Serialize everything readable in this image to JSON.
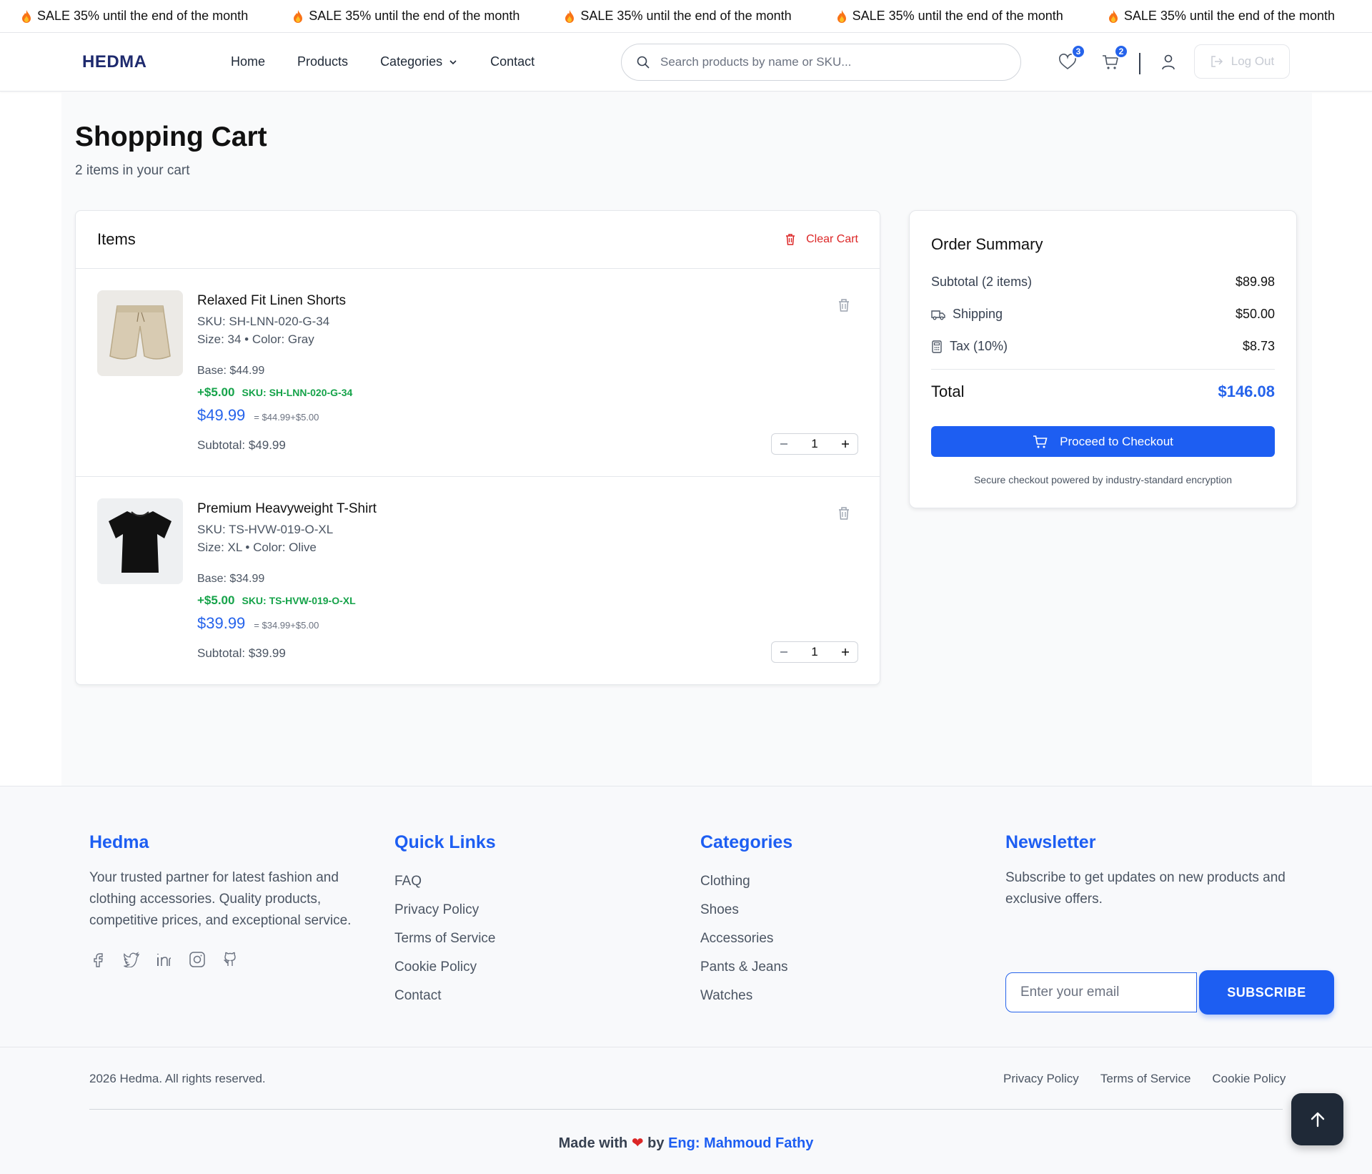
{
  "ticker": {
    "items": [
      "SALE 35% until the end of the month",
      "SALE 35% until the end of the month",
      "SALE 35% until the end of the month",
      "SALE 35% until the end of the month",
      "SALE 35% until the end of the month"
    ]
  },
  "nav": {
    "logo": "HEDMA",
    "links": [
      "Home",
      "Products",
      "Categories",
      "Contact"
    ],
    "search_placeholder": "Search products by name or SKU...",
    "wishlist_count": "3",
    "cart_count": "2",
    "logout_label": "Log Out"
  },
  "page": {
    "title": "Shopping Cart",
    "subtitle": "2 items in your cart"
  },
  "cart": {
    "header": "Items",
    "clear_label": "Clear Cart",
    "items": [
      {
        "name": "Relaxed Fit Linen Shorts",
        "sku": "SKU: SH-LNN-020-G-34",
        "options": "Size: 34 • Color: Gray",
        "base": "Base: $44.99",
        "extra": "+$5.00",
        "extra_sku": "SKU: SH-LNN-020-G-34",
        "price": "$49.99",
        "formula": "= $44.99+$5.00",
        "subtotal": "Subtotal: $49.99",
        "qty": "1",
        "image": "linen-shorts-photo"
      },
      {
        "name": "Premium Heavyweight T-Shirt",
        "sku": "SKU: TS-HVW-019-O-XL",
        "options": "Size: XL • Color: Olive",
        "base": "Base: $34.99",
        "extra": "+$5.00",
        "extra_sku": "SKU: TS-HVW-019-O-XL",
        "price": "$39.99",
        "formula": "= $34.99+$5.00",
        "subtotal": "Subtotal: $39.99",
        "qty": "1",
        "image": "black-tshirt-photo"
      }
    ]
  },
  "summary": {
    "title": "Order Summary",
    "subtotal_label": "Subtotal (2 items)",
    "subtotal": "$89.98",
    "shipping_label": "Shipping",
    "shipping": "$50.00",
    "tax_label": "Tax (10%)",
    "tax": "$8.73",
    "total_label": "Total",
    "total": "$146.08",
    "checkout_label": "Proceed to Checkout",
    "secure_note": "Secure checkout powered by industry-standard encryption"
  },
  "footer": {
    "brand_title": "Hedma",
    "brand_text": "Your trusted partner for latest fashion and clothing accessories. Quality products, competitive prices, and exceptional service.",
    "quick_title": "Quick Links",
    "quick_links": [
      "FAQ",
      "Privacy Policy",
      "Terms of Service",
      "Cookie Policy",
      "Contact"
    ],
    "categories_title": "Categories",
    "categories": [
      "Clothing",
      "Shoes",
      "Accessories",
      "Pants & Jeans",
      "Watches"
    ],
    "newsletter_title": "Newsletter",
    "newsletter_text": "Subscribe to get updates on new products and exclusive offers.",
    "email_placeholder": "Enter your email",
    "subscribe_label": "SUBSCRIBE",
    "copyright": "2026 Hedma. All rights reserved.",
    "legal_links": [
      "Privacy Policy",
      "Terms of Service",
      "Cookie Policy"
    ],
    "made_with": "Made with",
    "by": "by",
    "author": "Eng: Mahmoud Fathy",
    "socials": [
      "facebook-icon",
      "twitter-icon",
      "linkedin-icon",
      "instagram-icon",
      "github-icon"
    ]
  },
  "colors": {
    "accent": "#1d5ef2",
    "price_blue": "#2563eb",
    "extra_green": "#16a34a",
    "danger": "#dc2626"
  }
}
